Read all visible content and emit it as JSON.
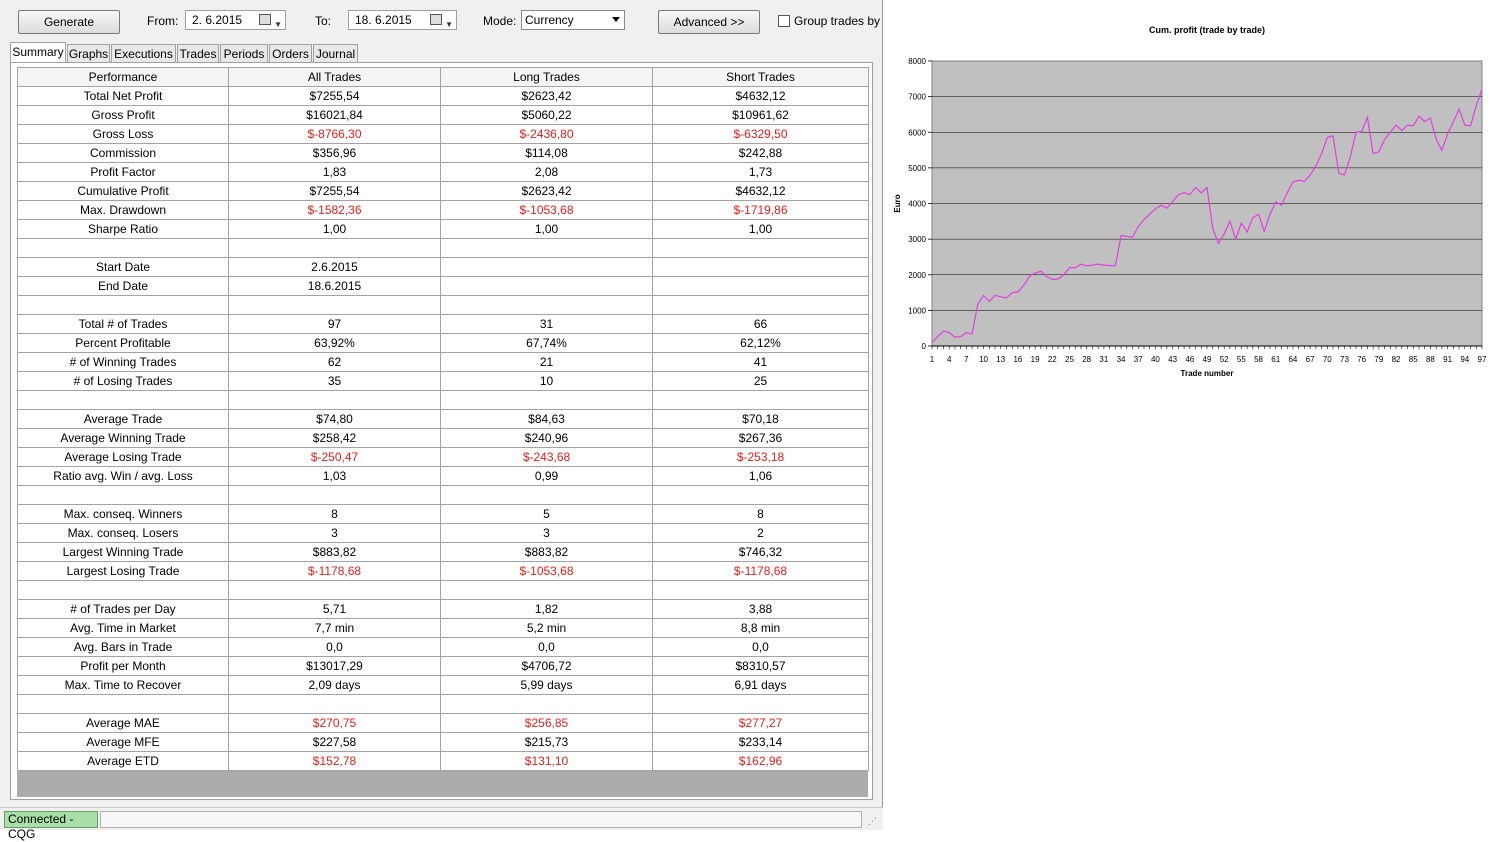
{
  "toolbar": {
    "generate_label": "Generate",
    "from_label": "From:",
    "from_value": "2. 6.2015",
    "to_label": "To:",
    "to_value": "18. 6.2015",
    "mode_label": "Mode:",
    "mode_value": "Currency",
    "advanced_label": "Advanced >>",
    "group_label": "Group trades by"
  },
  "tabs": [
    "Summary",
    "Graphs",
    "Executions",
    "Trades",
    "Periods",
    "Orders",
    "Journal"
  ],
  "table": {
    "headers": [
      "Performance",
      "All Trades",
      "Long Trades",
      "Short Trades"
    ],
    "rows": [
      [
        "Total Net Profit",
        "$7255,54",
        "$2623,42",
        "$4632,12"
      ],
      [
        "Gross Profit",
        "$16021,84",
        "$5060,22",
        "$10961,62"
      ],
      [
        "Gross Loss",
        "$-8766,30",
        "$-2436,80",
        "$-6329,50"
      ],
      [
        "Commission",
        "$356,96",
        "$114,08",
        "$242,88"
      ],
      [
        "Profit Factor",
        "1,83",
        "2,08",
        "1,73"
      ],
      [
        "Cumulative Profit",
        "$7255,54",
        "$2623,42",
        "$4632,12"
      ],
      [
        "Max. Drawdown",
        "$-1582,36",
        "$-1053,68",
        "$-1719,86"
      ],
      [
        "Sharpe Ratio",
        "1,00",
        "1,00",
        "1,00"
      ],
      [
        "",
        "",
        "",
        ""
      ],
      [
        "Start Date",
        "2.6.2015",
        "",
        ""
      ],
      [
        "End Date",
        "18.6.2015",
        "",
        ""
      ],
      [
        "",
        "",
        "",
        ""
      ],
      [
        "Total # of Trades",
        "97",
        "31",
        "66"
      ],
      [
        "Percent Profitable",
        "63,92%",
        "67,74%",
        "62,12%"
      ],
      [
        "# of Winning Trades",
        "62",
        "21",
        "41"
      ],
      [
        "# of Losing Trades",
        "35",
        "10",
        "25"
      ],
      [
        "",
        "",
        "",
        ""
      ],
      [
        "Average Trade",
        "$74,80",
        "$84,63",
        "$70,18"
      ],
      [
        "Average Winning Trade",
        "$258,42",
        "$240,96",
        "$267,36"
      ],
      [
        "Average Losing Trade",
        "$-250,47",
        "$-243,68",
        "$-253,18"
      ],
      [
        "Ratio avg. Win / avg. Loss",
        "1,03",
        "0,99",
        "1,06"
      ],
      [
        "",
        "",
        "",
        ""
      ],
      [
        "Max. conseq. Winners",
        "8",
        "5",
        "8"
      ],
      [
        "Max. conseq. Losers",
        "3",
        "3",
        "2"
      ],
      [
        "Largest Winning Trade",
        "$883,82",
        "$883,82",
        "$746,32"
      ],
      [
        "Largest Losing Trade",
        "$-1178,68",
        "$-1053,68",
        "$-1178,68"
      ],
      [
        "",
        "",
        "",
        ""
      ],
      [
        "# of Trades per Day",
        "5,71",
        "1,82",
        "3,88"
      ],
      [
        "Avg. Time in Market",
        "7,7 min",
        "5,2 min",
        "8,8 min"
      ],
      [
        "Avg. Bars in Trade",
        "0,0",
        "0,0",
        "0,0"
      ],
      [
        "Profit per Month",
        "$13017,29",
        "$4706,72",
        "$8310,57"
      ],
      [
        "Max. Time to Recover",
        "2,09 days",
        "5,99 days",
        "6,91 days"
      ],
      [
        "",
        "",
        "",
        ""
      ],
      [
        "Average MAE",
        "$270,75",
        "$256,85",
        "$277,27"
      ],
      [
        "Average MFE",
        "$227,58",
        "$215,73",
        "$233,14"
      ],
      [
        "Average ETD",
        "$152,78",
        "$131,10",
        "$162,96"
      ]
    ]
  },
  "colors": {
    "negative": "#e02020",
    "status_bg": "#a8e0a8",
    "plot_bg": "#c0c0c0",
    "line": "#e040e0"
  },
  "status": {
    "text": "Connected - CQG"
  },
  "chart_data": {
    "type": "line",
    "title": "Cum. profit (trade by trade)",
    "xlabel": "Trade number",
    "ylabel": "Euro",
    "ylim": [
      0,
      8000
    ],
    "yticks": [
      0,
      1000,
      2000,
      3000,
      4000,
      5000,
      6000,
      7000,
      8000
    ],
    "xlim": [
      1,
      97
    ],
    "xticks": [
      1,
      4,
      7,
      10,
      13,
      16,
      19,
      22,
      25,
      28,
      31,
      34,
      37,
      40,
      43,
      46,
      49,
      52,
      55,
      58,
      61,
      64,
      67,
      70,
      73,
      76,
      79,
      82,
      85,
      88,
      91,
      94,
      97
    ],
    "grid": true,
    "legend": "none",
    "series": [
      {
        "values": [
          90,
          270,
          420,
          380,
          250,
          260,
          380,
          340,
          1180,
          1420,
          1250,
          1420,
          1380,
          1350,
          1500,
          1520,
          1700,
          1950,
          2050,
          2100,
          1950,
          1870,
          1880,
          2000,
          2200,
          2200,
          2300,
          2250,
          2270,
          2300,
          2270,
          2260,
          2250,
          3100,
          3080,
          3050,
          3350,
          3550,
          3700,
          3850,
          3950,
          3870,
          4050,
          4250,
          4300,
          4250,
          4450,
          4300,
          4450,
          3300,
          2880,
          3150,
          3500,
          3000,
          3450,
          3200,
          3600,
          3700,
          3220,
          3700,
          4050,
          3950,
          4300,
          4600,
          4650,
          4620,
          4800,
          5050,
          5400,
          5850,
          5900,
          4850,
          4800,
          5300,
          6000,
          6020,
          6420,
          5400,
          5450,
          5800,
          6000,
          6200,
          6050,
          6200,
          6180,
          6450,
          6300,
          6400,
          5800,
          5500,
          5950,
          6300,
          6650,
          6200,
          6180,
          6750,
          7200
        ]
      }
    ]
  }
}
